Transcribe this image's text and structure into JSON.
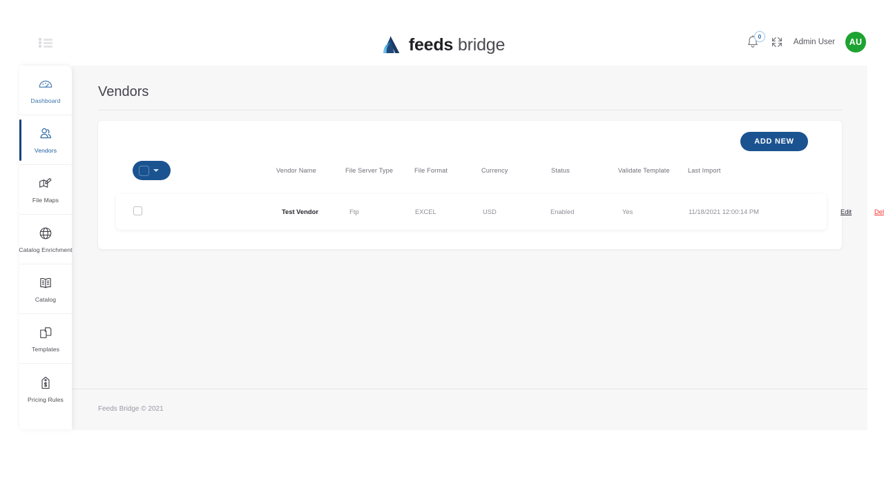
{
  "brand": {
    "logo_icon": "feeds-bridge-triangle-logo",
    "name_bold": "feeds",
    "name_light": "bridge"
  },
  "topbar": {
    "menu_icon": "list-menu-icon",
    "bell_icon": "bell-icon",
    "notification_count": "0",
    "fullscreen_icon": "expand-fullscreen-icon",
    "user_name": "Admin User",
    "avatar_initials": "AU",
    "avatar_color": "#1da331"
  },
  "sidebar": {
    "items": [
      {
        "label": "Dashboard",
        "icon": "gauge-icon",
        "active": false
      },
      {
        "label": "Vendors",
        "icon": "users-icon",
        "active": true
      },
      {
        "label": "File Maps",
        "icon": "map-icon",
        "active": false
      },
      {
        "label": "Catalog Enrichment",
        "icon": "globe-icon",
        "active": false
      },
      {
        "label": "Catalog",
        "icon": "open-book-icon",
        "active": false
      },
      {
        "label": "Templates",
        "icon": "documents-icon",
        "active": false
      },
      {
        "label": "Pricing Rules",
        "icon": "price-tag-icon",
        "active": false
      }
    ]
  },
  "main": {
    "page_title": "Vendors",
    "add_new_label": "ADD NEW",
    "select_all_caret_icon": "chevron-down-icon",
    "columns": [
      "Vendor Name",
      "File Server Type",
      "File Format",
      "Currency",
      "Status",
      "Validate Template",
      "Last Import"
    ],
    "rows": [
      {
        "vendor_name": "Test Vendor",
        "file_server_type": "Ftp",
        "file_format": "EXCEL",
        "currency": "USD",
        "status": "Enabled",
        "validate_template": "Yes",
        "last_import": "11/18/2021 12:00:14 PM",
        "edit_label": "Edit",
        "delete_label": "Delete"
      }
    ]
  },
  "footer": {
    "text": "Feeds Bridge © 2021"
  },
  "colors": {
    "brand_navy": "#1b5390",
    "accent_blue": "#15447c",
    "danger_red": "#f3312f",
    "avatar_green": "#1da331",
    "page_bg": "#f7f7f8"
  }
}
